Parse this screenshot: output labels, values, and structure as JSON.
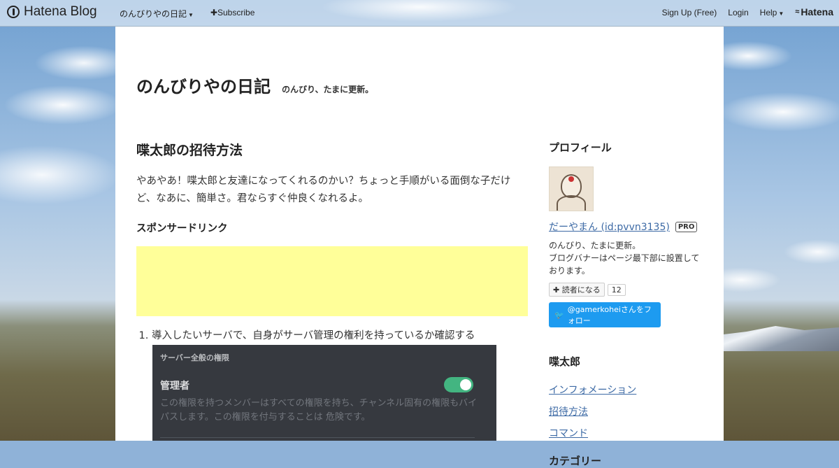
{
  "topbar": {
    "brand": "Hatena Blog",
    "blog_menu": "のんびりやの日記",
    "subscribe": "Subscribe",
    "signup": "Sign Up (Free)",
    "login": "Login",
    "help": "Help",
    "hatena": "Hatena"
  },
  "blog": {
    "title": "のんびりやの日記",
    "description": "のんびり、たまに更新。"
  },
  "entry": {
    "title": "喋太郎の招待方法",
    "intro": "やあやあ！喋太郎と友達になってくれるのかい？ちょっと手順がいる面倒な子だけど、なあに、簡単さ。君ならすぐ仲良くなれるよ。",
    "sponsor_label": "スポンサードリンク",
    "steps": [
      "導入したいサーバで、自身がサーバ管理の権利を持っているか確認する"
    ],
    "screenshot": {
      "section": "サーバー全般の権限",
      "role": "管理者",
      "desc": "この権限を持つメンバーはすべての権限を持ち、チャンネル固有の権限もバイパスします。この権限を付与することは 危険です。"
    }
  },
  "sidebar": {
    "profile_heading": "プロフィール",
    "profile_name": "だーやまん (id:pvvn3135)",
    "pro_badge": "PRO",
    "profile_desc_1": "のんびり、たまに更新。",
    "profile_desc_2": "ブログバナーはページ最下部に設置しております。",
    "reader_button": "読者になる",
    "reader_count": "12",
    "twitter_follow": "@gamerkoheiさんをフォロー",
    "section2_heading": "喋太郎",
    "links": [
      "インフォメーション",
      "招待方法",
      "コマンド"
    ],
    "section3_heading": "カテゴリー"
  }
}
